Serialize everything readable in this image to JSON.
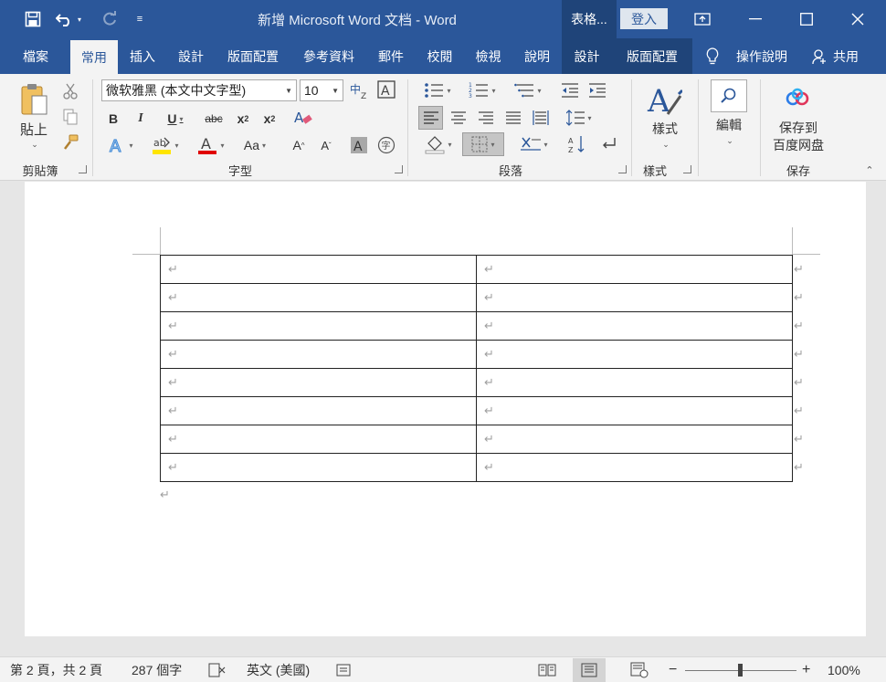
{
  "window": {
    "title": "新增 Microsoft Word 文档 - Word",
    "context_title": "表格...",
    "signin_label": "登入"
  },
  "tabs": [
    {
      "label": "檔案"
    },
    {
      "label": "常用"
    },
    {
      "label": "插入"
    },
    {
      "label": "設計"
    },
    {
      "label": "版面配置"
    },
    {
      "label": "參考資料"
    },
    {
      "label": "郵件"
    },
    {
      "label": "校閱"
    },
    {
      "label": "檢視"
    },
    {
      "label": "說明"
    },
    {
      "label": "設計"
    },
    {
      "label": "版面配置"
    }
  ],
  "tell_me": "操作說明",
  "share": "共用",
  "ribbon": {
    "clipboard": {
      "label": "剪貼簿",
      "paste": "貼上"
    },
    "font": {
      "label": "字型",
      "font_name": "微软雅黑 (本文中文字型)",
      "font_size": "10"
    },
    "paragraph": {
      "label": "段落"
    },
    "styles": {
      "label": "樣式",
      "button": "樣式"
    },
    "editing": {
      "button": "編輯"
    },
    "save": {
      "label": "保存",
      "button_line1": "保存到",
      "button_line2": "百度网盘"
    },
    "accent_color": "#2b579a",
    "highlight_color": "#ffe500",
    "font_color": "#e00000"
  },
  "document": {
    "para_mark": "↵",
    "rows": 8,
    "cols": 2
  },
  "status": {
    "page": "第 2 頁，共 2 頁",
    "words": "287 個字",
    "language": "英文 (美國)",
    "zoom": "100%",
    "zoom_level_percent": 100
  }
}
